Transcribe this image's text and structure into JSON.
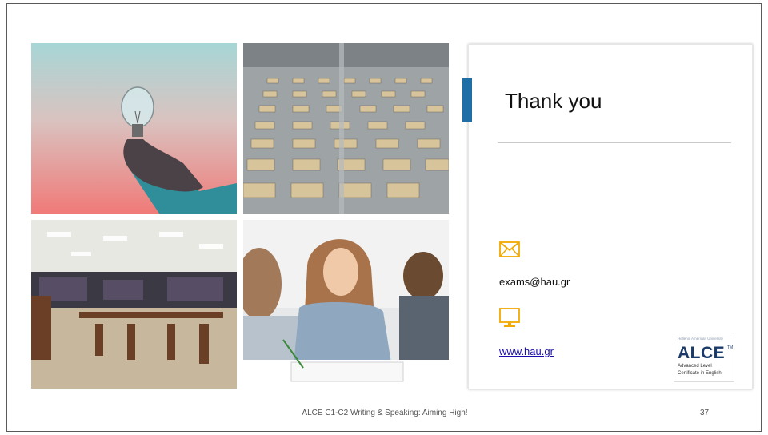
{
  "card": {
    "title": "Thank you",
    "email": "exams@hau.gr",
    "website": "www.hau.gr"
  },
  "logo": {
    "university": "Hellenic American University",
    "name": "ALCE",
    "tm": "TM",
    "line1": "Advanced Level",
    "line2": "Certificate in English"
  },
  "footer": {
    "text": "ALCE C1-C2 Writing & Speaking: Aiming High!",
    "page_number": "37"
  },
  "colors": {
    "accent": "#1f6fa6",
    "icon": "#f2a900",
    "link": "#1a0dab"
  },
  "icons": {
    "email": "envelope-icon",
    "website": "monitor-icon"
  }
}
